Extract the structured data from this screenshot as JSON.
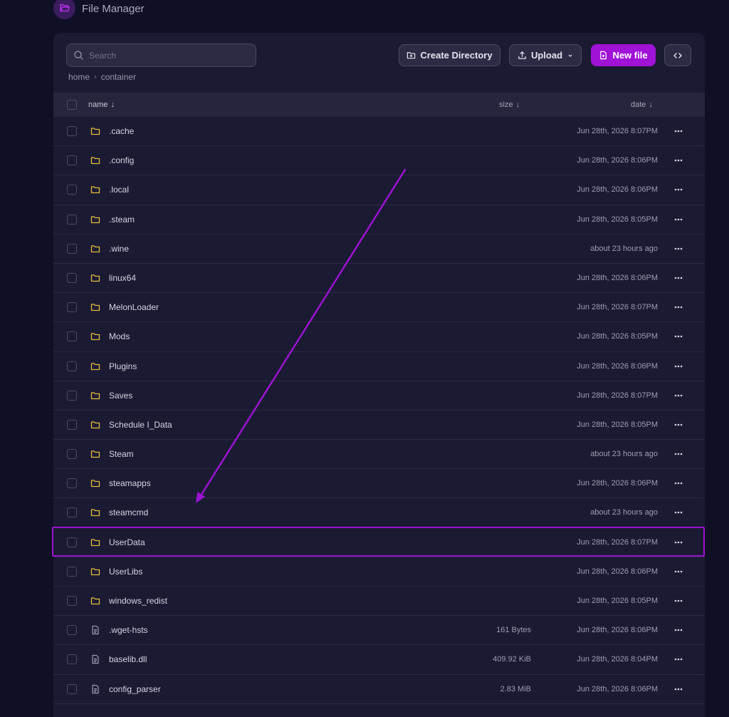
{
  "app": {
    "title": "File Manager",
    "icon": "folder-open-icon",
    "accent": "#a012d6"
  },
  "toolbar": {
    "search_placeholder": "Search",
    "create_label": "Create Directory",
    "upload_label": "Upload",
    "new_file_label": "New file"
  },
  "breadcrumb": [
    "home",
    "container"
  ],
  "table": {
    "headers": {
      "name": "name",
      "size": "size",
      "date": "date",
      "sort_arrow": "↓"
    },
    "rows": [
      {
        "name": ".cache",
        "type": "folder",
        "size": "",
        "date": "Jun 28th, 2026 8:07PM"
      },
      {
        "name": ".config",
        "type": "folder",
        "size": "",
        "date": "Jun 28th, 2026 8:06PM"
      },
      {
        "name": ".local",
        "type": "folder",
        "size": "",
        "date": "Jun 28th, 2026 8:06PM"
      },
      {
        "name": ".steam",
        "type": "folder",
        "size": "",
        "date": "Jun 28th, 2026 8:05PM"
      },
      {
        "name": ".wine",
        "type": "folder",
        "size": "",
        "date": "about 23 hours ago"
      },
      {
        "name": "linux64",
        "type": "folder",
        "size": "",
        "date": "Jun 28th, 2026 8:06PM"
      },
      {
        "name": "MelonLoader",
        "type": "folder",
        "size": "",
        "date": "Jun 28th, 2026 8:07PM"
      },
      {
        "name": "Mods",
        "type": "folder",
        "size": "",
        "date": "Jun 28th, 2026 8:05PM"
      },
      {
        "name": "Plugins",
        "type": "folder",
        "size": "",
        "date": "Jun 28th, 2026 8:06PM"
      },
      {
        "name": "Saves",
        "type": "folder",
        "size": "",
        "date": "Jun 28th, 2026 8:07PM"
      },
      {
        "name": "Schedule I_Data",
        "type": "folder",
        "size": "",
        "date": "Jun 28th, 2026 8:05PM"
      },
      {
        "name": "Steam",
        "type": "folder",
        "size": "",
        "date": "about 23 hours ago"
      },
      {
        "name": "steamapps",
        "type": "folder",
        "size": "",
        "date": "Jun 28th, 2026 8:06PM"
      },
      {
        "name": "steamcmd",
        "type": "folder",
        "size": "",
        "date": "about 23 hours ago"
      },
      {
        "name": "UserData",
        "type": "folder",
        "size": "",
        "date": "Jun 28th, 2026 8:07PM"
      },
      {
        "name": "UserLibs",
        "type": "folder",
        "size": "",
        "date": "Jun 28th, 2026 8:06PM"
      },
      {
        "name": "windows_redist",
        "type": "folder",
        "size": "",
        "date": "Jun 28th, 2026 8:05PM"
      },
      {
        "name": ".wget-hsts",
        "type": "file",
        "size": "161 Bytes",
        "date": "Jun 28th, 2026 8:06PM"
      },
      {
        "name": "baselib.dll",
        "type": "file",
        "size": "409.92 KiB",
        "date": "Jun 28th, 2026 8:04PM"
      },
      {
        "name": "config_parser",
        "type": "file",
        "size": "2.83 MiB",
        "date": "Jun 28th, 2026 8:06PM"
      }
    ]
  },
  "annotation": {
    "highlighted_row": "UserData",
    "color": "#9b12d0"
  },
  "colors": {
    "background": "#0f0f26",
    "panel": "#1a1a33",
    "folder_icon": "#e6b93a",
    "file_icon": "#9c9eb2"
  }
}
